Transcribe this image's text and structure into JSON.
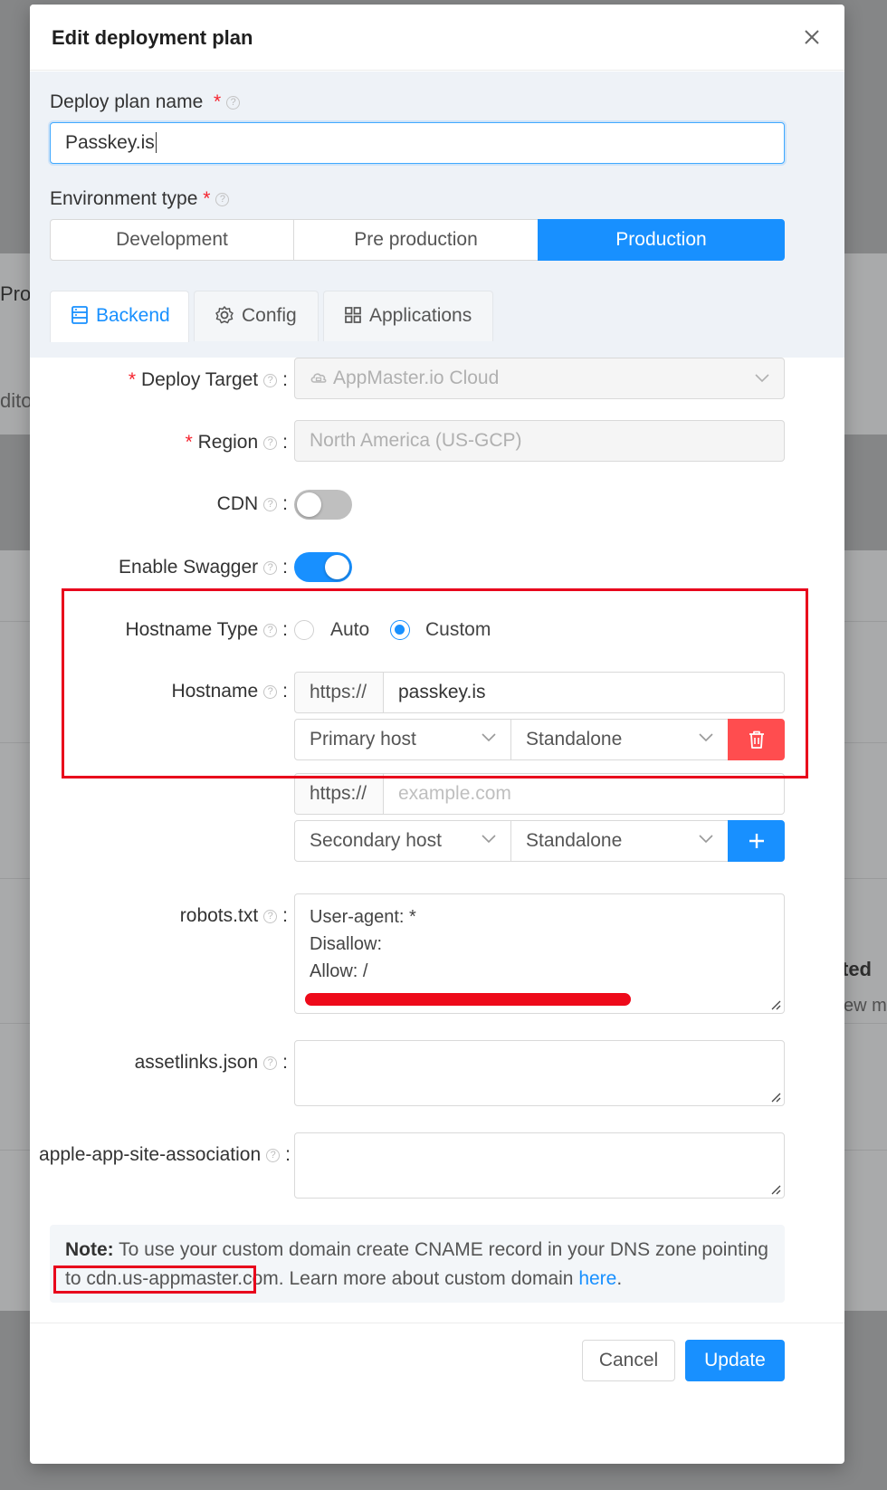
{
  "background": {
    "text_pro": "Pro",
    "text_edito": "dito",
    "text_ted": "ted",
    "text_ewm": "ew m"
  },
  "modal": {
    "title": "Edit deployment plan",
    "deploy_plan_name_label": "Deploy plan name",
    "deploy_plan_name_value": "Passkey.is",
    "environment_type_label": "Environment type",
    "required_mark": "*",
    "env_options": [
      "Development",
      "Pre production",
      "Production"
    ],
    "env_selected": "Production",
    "tabs": [
      {
        "label": "Backend",
        "icon": "server-icon",
        "active": true
      },
      {
        "label": "Config",
        "icon": "gear-icon",
        "active": false
      },
      {
        "label": "Applications",
        "icon": "grid-icon",
        "active": false
      }
    ]
  },
  "form": {
    "deploy_target_label": "Deploy Target",
    "deploy_target_value": "AppMaster.io Cloud",
    "region_label": "Region",
    "region_value": "North America (US-GCP)",
    "cdn_label": "CDN",
    "cdn_enabled": false,
    "swagger_label": "Enable Swagger",
    "swagger_enabled": true,
    "hostname_type_label": "Hostname Type",
    "hostname_type_options": [
      "Auto",
      "Custom"
    ],
    "hostname_type_selected": "Custom",
    "hostname_label": "Hostname",
    "hosts": [
      {
        "prefix": "https://",
        "value": "passkey.is",
        "placeholder": "",
        "role": "Primary host",
        "mode": "Standalone",
        "action": "delete"
      },
      {
        "prefix": "https://",
        "value": "",
        "placeholder": "example.com",
        "role": "Secondary host",
        "mode": "Standalone",
        "action": "add"
      }
    ],
    "robots_label": "robots.txt",
    "robots_lines": [
      "User-agent: *",
      "Disallow:",
      "Allow: /"
    ],
    "assetlinks_label": "assetlinks.json",
    "aasa_label": "apple-app-site-association"
  },
  "note": {
    "bold": "Note:",
    "text1": " To use your custom domain create CNAME record in your DNS zone pointing to ",
    "domain": "cdn.us-appmaster.com.",
    "text2": " Learn more about custom domain ",
    "link": "here",
    "end": "."
  },
  "footer": {
    "cancel": "Cancel",
    "update": "Update"
  },
  "colors": {
    "primary": "#1890ff",
    "danger": "#ff4d4f",
    "highlight": "#e8001c"
  }
}
